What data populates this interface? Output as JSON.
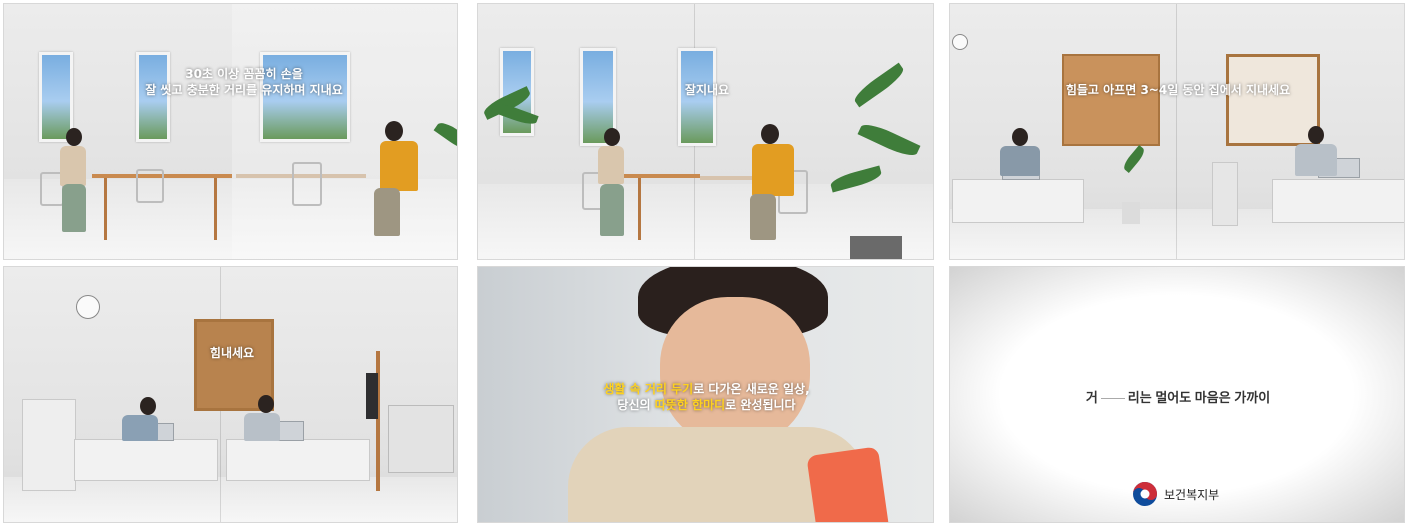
{
  "frames": [
    {
      "caption_lines": [
        [
          {
            "text": "30초 이상 꼼꼼히 손을",
            "highlight": false
          }
        ],
        [
          {
            "text": "잘 씻고 충분한 거리를 유지하며 ",
            "highlight": false
          },
          {
            "text": "지내요",
            "highlight": false
          }
        ]
      ]
    },
    {
      "caption_lines": [
        [
          {
            "text": "잘지내요",
            "highlight": false
          }
        ]
      ]
    },
    {
      "caption_lines": [
        [
          {
            "text": "힘들고 아프면 3~4일 동안 집에서 ",
            "highlight": false
          },
          {
            "text": "지내세요",
            "highlight": false
          }
        ]
      ]
    },
    {
      "caption_lines": [
        [
          {
            "text": "힘내세요",
            "highlight": false
          }
        ]
      ]
    },
    {
      "caption_lines": [
        [
          {
            "text": "생활 속 거리 두기",
            "highlight": true
          },
          {
            "text": "로 다가온 새로운 일상,",
            "highlight": false
          }
        ],
        [
          {
            "text": "당신의 ",
            "highlight": false
          },
          {
            "text": "따뜻한 한마디",
            "highlight": true
          },
          {
            "text": "로 완성됩니다",
            "highlight": false
          }
        ]
      ]
    },
    {
      "slogan_part1": "거",
      "slogan_part2": "리는 멀어도  마음은 가까이",
      "ministry_name": "보건복지부",
      "logo_icon": "taegeuk-logo-icon"
    }
  ],
  "colors": {
    "caption_text": "#ffffff",
    "caption_highlight": "#ffd21f",
    "slogan_text": "#333333",
    "logo_red": "#cd2e3a",
    "logo_blue": "#0f4c9c"
  }
}
